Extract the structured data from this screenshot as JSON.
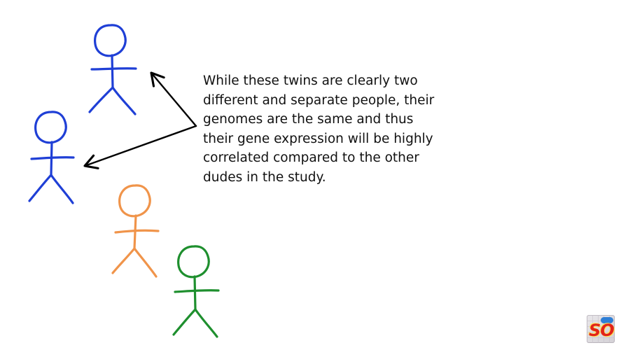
{
  "explanation": {
    "text": "While these twins are clearly two\ndifferent and separate people, their\ngenomes are the same and thus\ntheir gene expression will be highly\ncorrelated compared to the other\ndudes in the study."
  },
  "colors": {
    "twin": "#1f3fd6",
    "orange_person": "#f0944a",
    "green_person": "#1e8f2e",
    "arrow": "#000000"
  },
  "icons": {
    "logo": "so-logo-icon"
  }
}
